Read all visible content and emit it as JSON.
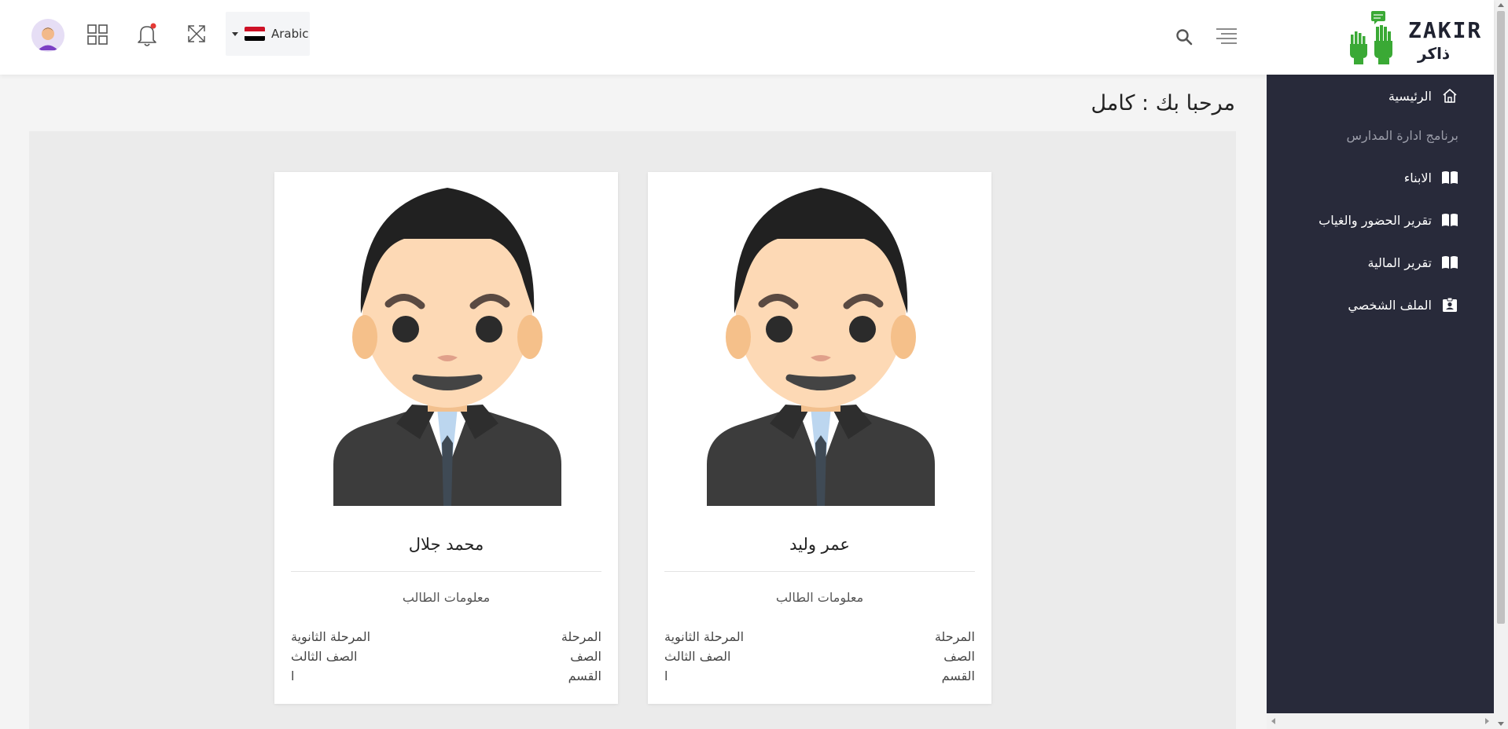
{
  "header": {
    "language_label": "Arabic",
    "flag_colors": [
      "#ce1126",
      "#ffffff",
      "#000000"
    ]
  },
  "logo": {
    "text_en": "ZAKIR",
    "text_ar": "ذاكر",
    "color": "#3aa935"
  },
  "sidebar": {
    "items": [
      {
        "label": "الرئيسية",
        "icon": "home-icon"
      },
      {
        "label": "برنامج ادارة المدارس",
        "icon": ""
      },
      {
        "label": "الابناء",
        "icon": "book-icon"
      },
      {
        "label": "تقرير الحضور والغياب",
        "icon": "book-icon"
      },
      {
        "label": "تقرير المالية",
        "icon": "book-icon"
      },
      {
        "label": "الملف الشخصي",
        "icon": "id-badge-icon"
      }
    ]
  },
  "main": {
    "welcome": "مرحبا بك : كامل"
  },
  "students": [
    {
      "name": "عمر وليد",
      "info_title": "معلومات الطالب",
      "fields": [
        {
          "label": "المرحلة",
          "value": "المرحلة الثانوية"
        },
        {
          "label": "الصف",
          "value": "الصف الثالث"
        },
        {
          "label": "القسم",
          "value": "ا"
        }
      ]
    },
    {
      "name": "محمد جلال",
      "info_title": "معلومات الطالب",
      "fields": [
        {
          "label": "المرحلة",
          "value": "المرحلة الثانوية"
        },
        {
          "label": "الصف",
          "value": "الصف الثالث"
        },
        {
          "label": "القسم",
          "value": "ا"
        }
      ]
    }
  ],
  "colors": {
    "sidebar_bg": "#282a3a",
    "notification_dot": "#e53935"
  }
}
